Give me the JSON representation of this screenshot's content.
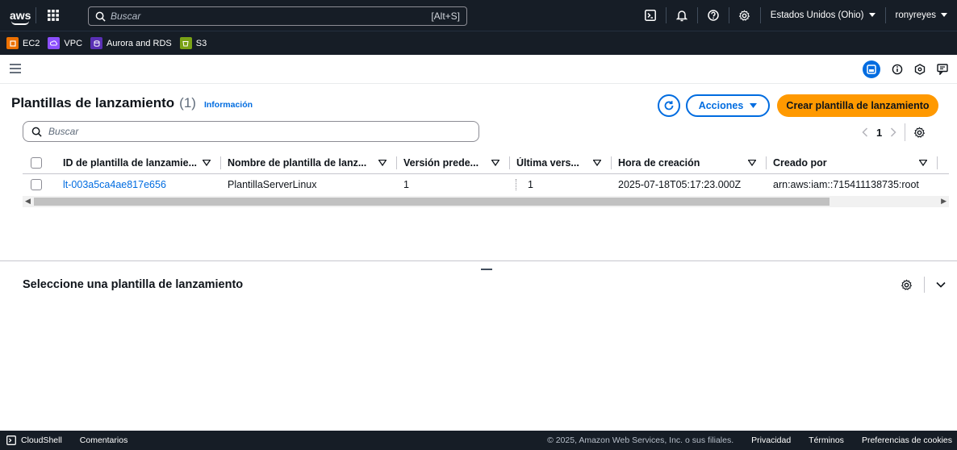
{
  "topnav": {
    "logo": "aws",
    "search_placeholder": "Buscar",
    "search_shortcut": "[Alt+S]",
    "region": "Estados Unidos (Ohio)",
    "user": "ronyreyes"
  },
  "favorites": [
    {
      "label": "EC2",
      "color": "#ed7100"
    },
    {
      "label": "VPC",
      "color": "#8c4fff"
    },
    {
      "label": "Aurora and RDS",
      "color": "#5a30b5"
    },
    {
      "label": "S3",
      "color": "#7aa116"
    }
  ],
  "page": {
    "title": "Plantillas de lanzamiento",
    "count": "(1)",
    "info": "Información",
    "actions_label": "Acciones",
    "create_label": "Crear plantilla de lanzamiento",
    "search_placeholder": "Buscar",
    "current_page": "1"
  },
  "table": {
    "columns": [
      "ID de plantilla de lanzamie...",
      "Nombre de plantilla de lanz...",
      "Versión prede...",
      "Última vers...",
      "Hora de creación",
      "Creado por"
    ],
    "rows": [
      {
        "id": "lt-003a5ca4ae817e656",
        "name": "PlantillaServerLinux",
        "default_version": "1",
        "latest_version": "1",
        "created": "2025-07-18T05:17:23.000Z",
        "created_by": "arn:aws:iam::715411138735:root"
      }
    ]
  },
  "split_panel": {
    "title": "Seleccione una plantilla de lanzamiento"
  },
  "footer": {
    "cloudshell": "CloudShell",
    "feedback": "Comentarios",
    "copyright": "© 2025, Amazon Web Services, Inc. o sus filiales.",
    "privacy": "Privacidad",
    "terms": "Términos",
    "cookies": "Preferencias de cookies"
  },
  "colors": {
    "nav_bg": "#161d26",
    "link": "#006ce0",
    "primary": "#ff9900"
  }
}
